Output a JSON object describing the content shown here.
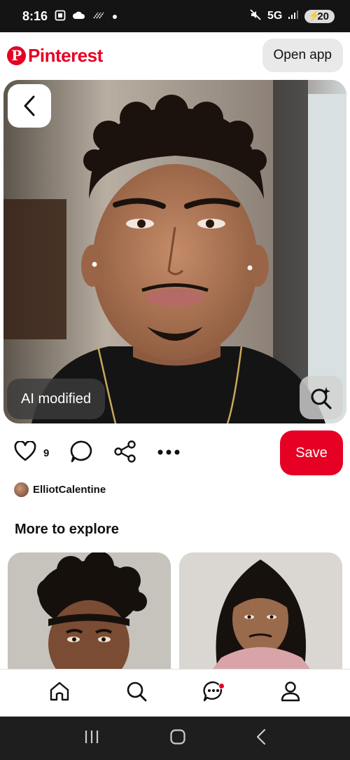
{
  "status_bar": {
    "time": "8:16",
    "network": "5G",
    "battery": "20"
  },
  "header": {
    "logo_text": "Pinterest",
    "open_app_label": "Open app"
  },
  "pin": {
    "ai_badge_label": "AI modified",
    "like_count": "9",
    "save_label": "Save",
    "creator_name": "ElliotCalentine"
  },
  "explore": {
    "title": "More to explore"
  },
  "colors": {
    "brand_red": "#e60023",
    "status_bar_bg": "#141414",
    "system_nav_bg": "#1e1e1e"
  },
  "icons": {
    "status_left": [
      "screenshot-icon",
      "cloud-icon",
      "signal-strength-icon",
      "dot-icon"
    ],
    "status_right": [
      "mute-icon",
      "signal-icon",
      "battery-charging-icon"
    ],
    "actions": [
      "heart-icon",
      "comment-icon",
      "share-icon",
      "more-icon"
    ],
    "bottom_nav": [
      "home-icon",
      "search-icon",
      "messages-icon",
      "profile-icon"
    ],
    "system_nav": [
      "recents-icon",
      "home-button-icon",
      "back-icon"
    ]
  }
}
